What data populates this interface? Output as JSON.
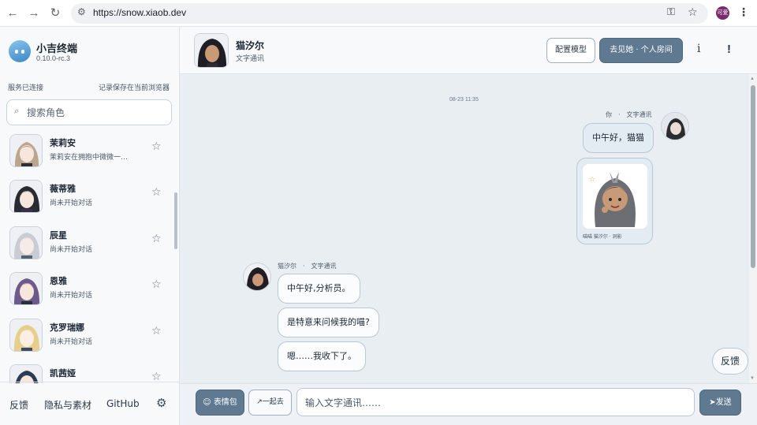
{
  "browser": {
    "url": "https://snow.xiaob.dev",
    "profile_initials": "可爱"
  },
  "app": {
    "name": "小吉终端",
    "version": "0.10.0-rc.3",
    "status": "服务已连接",
    "save_note": "记录保存在当前浏览器"
  },
  "search": {
    "placeholder": "搜索角色"
  },
  "characters": [
    {
      "name": "茉莉安",
      "subtitle": "茉莉安在拥抱中微微一…",
      "hair": "#b9a590"
    },
    {
      "name": "薇蒂雅",
      "subtitle": "尚未开始对话",
      "hair": "#2a2a33"
    },
    {
      "name": "辰星",
      "subtitle": "尚未开始对话",
      "hair": "#c9ccd2"
    },
    {
      "name": "恩雅",
      "subtitle": "尚未开始对话",
      "hair": "#6b5a8a"
    },
    {
      "name": "克罗瑞娜",
      "subtitle": "尚未开始对话",
      "hair": "#e6cf8a"
    },
    {
      "name": "凯茜娅",
      "subtitle": "",
      "hair": "#2b3a55"
    }
  ],
  "footer": {
    "feedback": "反馈",
    "privacy": "隐私与素材",
    "github": "GitHub"
  },
  "header": {
    "name": "猫汐尔",
    "subtitle": "文字通讯",
    "config_label": "配置模型",
    "room_label": "去见她 · 个人房间",
    "info_label": "i",
    "alert_label": "!"
  },
  "chat": {
    "timestamp": "08-23 11:35",
    "my_meta": "你　·　文字通讯",
    "my_message": "中午好，猫猫",
    "sticker_caption": "喵喵 猫汐尔 · 洞影",
    "her_meta": "猫汐尔　·　文字通讯",
    "her_messages": [
      "中午好,分析员。",
      "是特意来问候我的喵?",
      "嗯……我收下了。"
    ]
  },
  "floating_feedback": "反馈",
  "input": {
    "emoji_label": "表情包",
    "together_label": "一起去",
    "placeholder": "输入文字通讯……",
    "send_label": "发送"
  },
  "colors": {
    "accent": "#5e7990",
    "bubble_border": "#b9c7d4",
    "background": "#e9eef3"
  }
}
